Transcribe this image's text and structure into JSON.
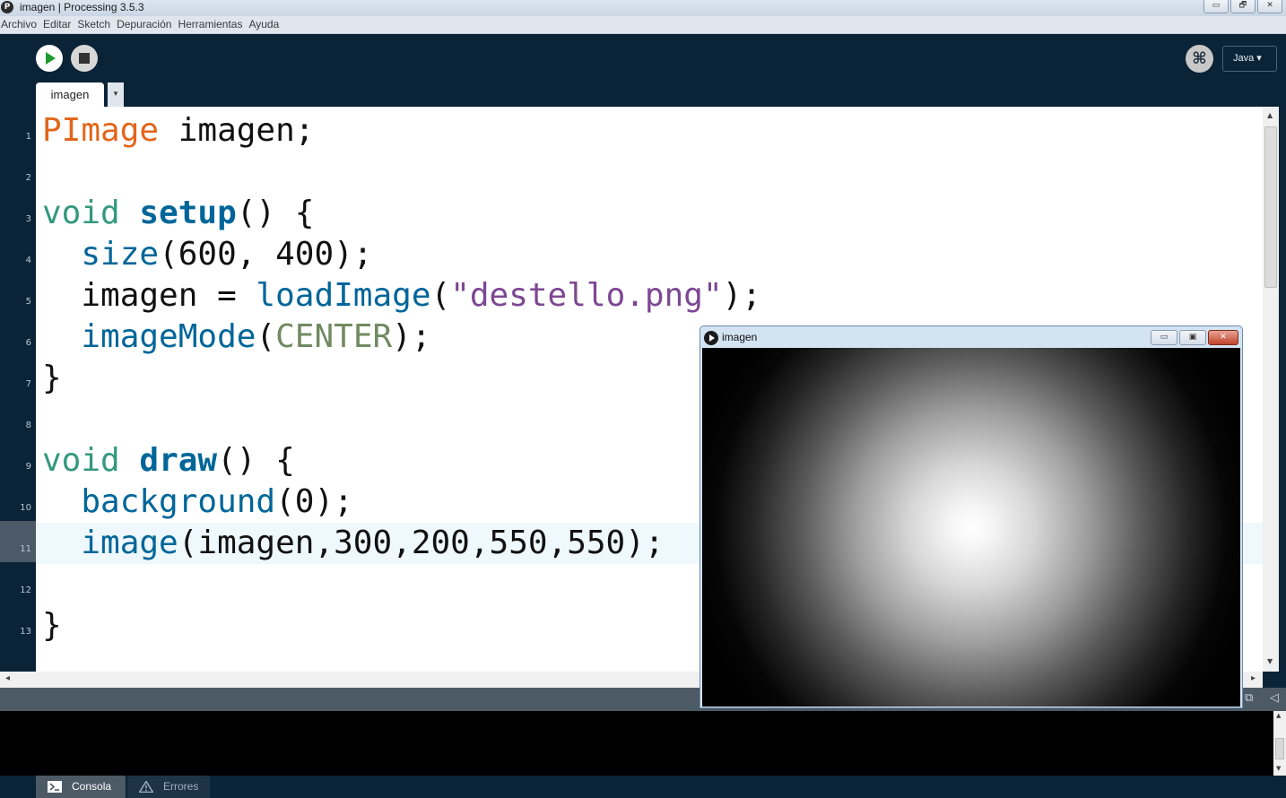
{
  "window": {
    "title": "imagen | Processing 3.5.3",
    "minimize": "▭",
    "restore": "🗗",
    "close": "✕"
  },
  "menu": [
    "Archivo",
    "Editar",
    "Sketch",
    "Depuración",
    "Herramientas",
    "Ayuda"
  ],
  "toolbar": {
    "mode_label": "Java ▾",
    "debug_icon": "⌘"
  },
  "tabs": {
    "active": "imagen",
    "menu_arrow": "▾"
  },
  "editor": {
    "highlighted_line": 11,
    "lines": [
      {
        "num": "1"
      },
      {
        "num": "2"
      },
      {
        "num": "3"
      },
      {
        "num": "4"
      },
      {
        "num": "5"
      },
      {
        "num": "6"
      },
      {
        "num": "7"
      },
      {
        "num": "8"
      },
      {
        "num": "9"
      },
      {
        "num": "10"
      },
      {
        "num": "11"
      },
      {
        "num": "12"
      },
      {
        "num": "13"
      }
    ],
    "code": {
      "l1_type": "PImage",
      "l1_rest": " imagen;",
      "l3_void": "void",
      "l3_fn": "setup",
      "l3_rest": "() {",
      "l4_fn": "size",
      "l4_rest": "(600, 400);",
      "l5_pre": "  imagen = ",
      "l5_fn": "loadImage",
      "l5_open": "(",
      "l5_str": "\"destello.png\"",
      "l5_close": ");",
      "l6_fn": "imageMode",
      "l6_open": "(",
      "l6_const": "CENTER",
      "l6_close": ");",
      "l7": "}",
      "l9_void": "void",
      "l9_fn": "draw",
      "l9_rest": "() {",
      "l10_fn": "background",
      "l10_rest": "(0);",
      "l11_fn": "image",
      "l11_rest": "(imagen,300,200,550,550);",
      "l13": "}"
    }
  },
  "console": {
    "tabs": [
      {
        "label": "Consola"
      },
      {
        "label": "Errores"
      }
    ]
  },
  "sketch_window": {
    "title": "imagen",
    "minimize": "▭",
    "restore": "▣",
    "close": "✕"
  }
}
